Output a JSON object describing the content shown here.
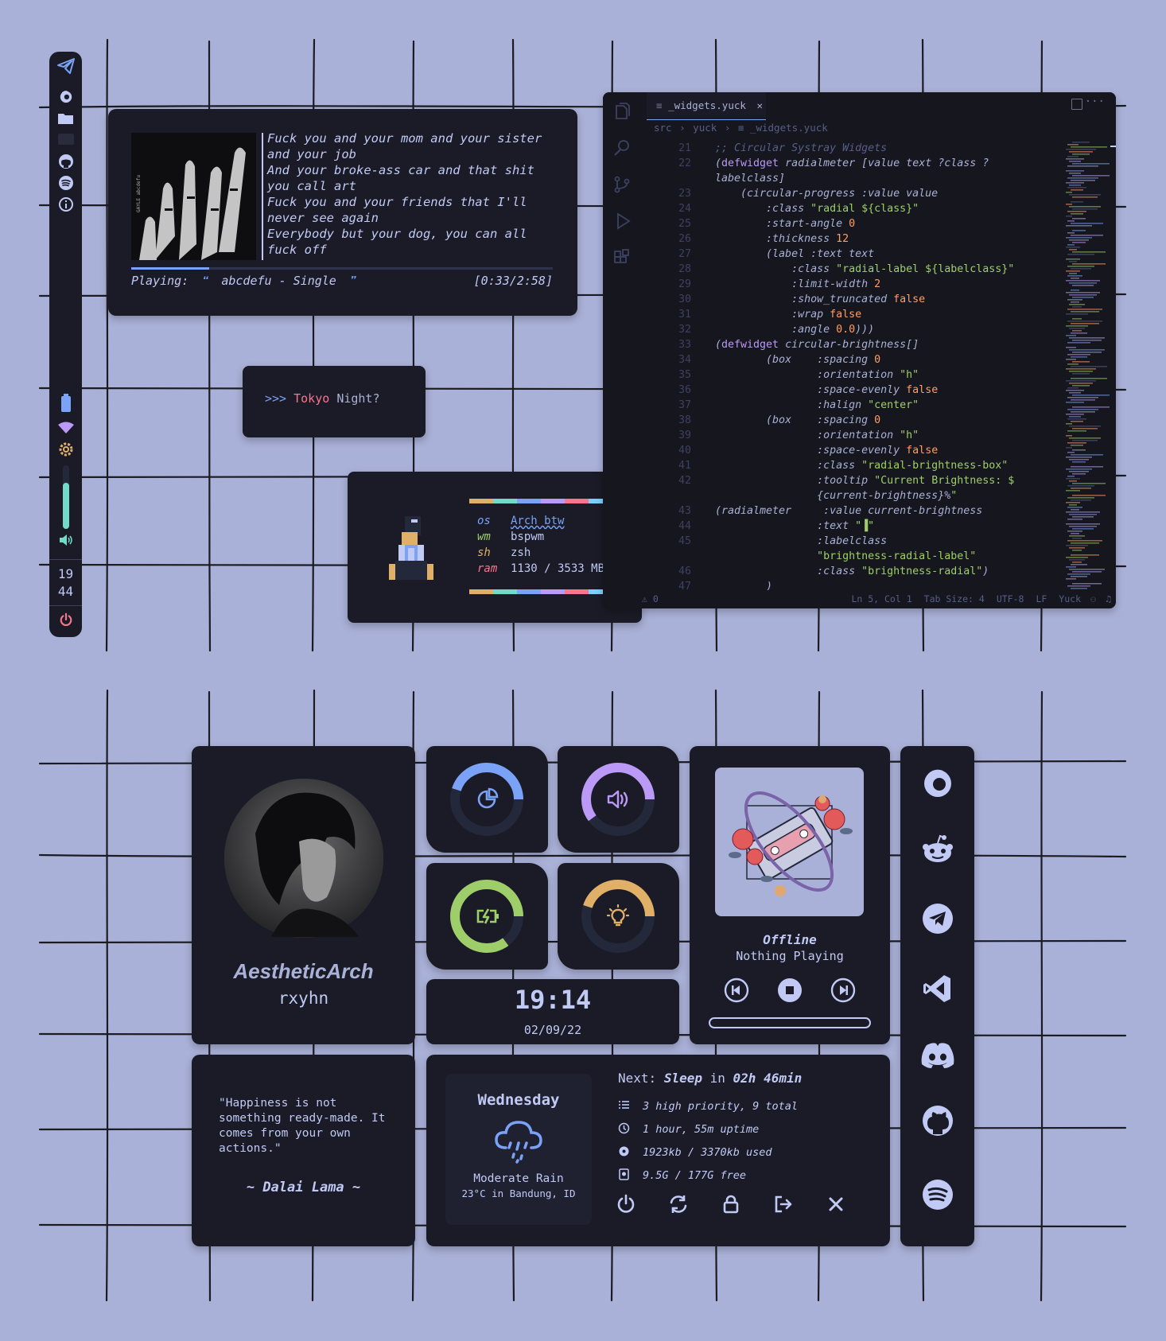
{
  "colors": {
    "background": "#aab1d8",
    "panel": "#1a1b26",
    "accent_blue": "#7aa2f7",
    "accent_purple": "#bb9af7",
    "accent_green": "#9ece6a",
    "accent_orange": "#e0af68",
    "accent_red": "#f7768e",
    "accent_cyan": "#73daca"
  },
  "sidebar": {
    "icons": [
      "telegram-icon",
      "firefox-icon",
      "folder-icon",
      "terminal-icon",
      "github-icon",
      "spotify-icon",
      "info-icon"
    ],
    "status_icons": [
      "battery-icon",
      "wifi-icon",
      "brightness-icon"
    ],
    "brightness_level": 0.72,
    "volume_icon": "volume-icon",
    "clock_hour": "19",
    "clock_minute": "44",
    "power_icon": "power-icon"
  },
  "music": {
    "album_caption": "GAYLE abcdefu",
    "lyrics": [
      "Fuck you and your mom and your sister",
      "and your job",
      "And your broke-ass car and that shit",
      "you call art",
      "Fuck you and your friends that I'll",
      "never see again",
      "Everybody but your dog, you can all",
      "fuck off"
    ],
    "playing_label": "Playing:",
    "open_quote": "❝",
    "track": "abcdefu - Single",
    "close_quote": "❞",
    "time": "[0:33/2:58]",
    "progress": 0.185
  },
  "prompt": {
    "arrows": ">>>",
    "word1": "Tokyo",
    "word2": "Night?"
  },
  "fetch": {
    "rows": [
      {
        "key": "os",
        "value": "Arch btw"
      },
      {
        "key": "wm",
        "value": "bspwm"
      },
      {
        "key": "sh",
        "value": "zsh"
      },
      {
        "key": "ram",
        "value": "1130 / 3533 MB"
      }
    ],
    "bar_colors": [
      "#e0af68",
      "#73daca",
      "#7aa2f7",
      "#bb9af7",
      "#f7768e",
      "#7dcfff"
    ]
  },
  "editor": {
    "tab_title": "_widgets.yuck",
    "breadcrumb": [
      "src",
      "yuck",
      "_widgets.yuck"
    ],
    "activity_icons": [
      "files-icon",
      "search-icon",
      "source-control-icon",
      "run-debug-icon",
      "extensions-icon"
    ],
    "status_left": "0",
    "status_items": [
      "Ln 5, Col 1",
      "Tab Size: 4",
      "UTF-8",
      "LF",
      "Yuck"
    ],
    "lines": [
      {
        "n": "21",
        "t": ";; Circular Systray Widgets"
      },
      {
        "n": "22",
        "t": "(defwidget radialmeter [value text ?class ?"
      },
      {
        "n": "",
        "t": "labelclass]"
      },
      {
        "n": "23",
        "t": "    (circular-progress :value value"
      },
      {
        "n": "24",
        "t": "        :class \"radial ${class}\""
      },
      {
        "n": "25",
        "t": "        :start-angle 0"
      },
      {
        "n": "26",
        "t": "        :thickness 12"
      },
      {
        "n": "27",
        "t": "        (label :text text"
      },
      {
        "n": "28",
        "t": "            :class \"radial-label ${labelclass}\""
      },
      {
        "n": "29",
        "t": "            :limit-width 2"
      },
      {
        "n": "30",
        "t": "            :show_truncated false"
      },
      {
        "n": "31",
        "t": "            :wrap false"
      },
      {
        "n": "32",
        "t": "            :angle 0.0)))"
      },
      {
        "n": "33",
        "t": "(defwidget circular-brightness[]"
      },
      {
        "n": "34",
        "t": "        (box    :spacing 0"
      },
      {
        "n": "35",
        "t": "                :orientation \"h\""
      },
      {
        "n": "36",
        "t": "                :space-evenly false"
      },
      {
        "n": "37",
        "t": "                :halign \"center\""
      },
      {
        "n": "38",
        "t": "        (box    :spacing 0"
      },
      {
        "n": "39",
        "t": "                :orientation \"h\""
      },
      {
        "n": "40",
        "t": "                :space-evenly false"
      },
      {
        "n": "41",
        "t": "                :class \"radial-brightness-box\""
      },
      {
        "n": "42",
        "t": "                :tooltip \"Current Brightness: $"
      },
      {
        "n": "",
        "t": "                {current-brightness}%\""
      },
      {
        "n": "43",
        "t": "(radialmeter     :value current-brightness"
      },
      {
        "n": "44",
        "t": "                :text \"▐\""
      },
      {
        "n": "45",
        "t": "                :labelclass"
      },
      {
        "n": "",
        "t": "                \"brightness-radial-label\""
      },
      {
        "n": "46",
        "t": "                :class \"brightness-radial\")"
      },
      {
        "n": "47",
        "t": "        )"
      }
    ]
  },
  "profile": {
    "name": "AestheticArch",
    "username": "rxyhn",
    "avatar_icon": "avatar-icon"
  },
  "meters": [
    {
      "name": "ram-meter",
      "icon": "pie-chart-icon",
      "color": "#7aa2f7",
      "value": 0.45
    },
    {
      "name": "volume-meter",
      "icon": "speaker-icon",
      "color": "#bb9af7",
      "value": 0.6
    },
    {
      "name": "battery-meter",
      "icon": "battery-charging-icon",
      "color": "#9ece6a",
      "value": 0.85
    },
    {
      "name": "brightness-meter",
      "icon": "lightbulb-icon",
      "color": "#e0af68",
      "value": 0.45
    }
  ],
  "clock": {
    "time": "19:14",
    "date": "02/09/22"
  },
  "player": {
    "status": "Offline",
    "title": "Nothing Playing",
    "cover_icon": "cassette-roses-icon"
  },
  "apps": [
    "firefox-icon",
    "reddit-icon",
    "telegram-icon",
    "vscode-icon",
    "discord-icon",
    "github-icon",
    "spotify-icon"
  ],
  "quote": {
    "text": "\"Happiness is not something ready-made. It comes from your own actions.\"",
    "author": "~ Dalai Lama ~"
  },
  "weather": {
    "day": "Wednesday",
    "icon": "rain-cloud-icon",
    "condition": "Moderate Rain",
    "temp_location": "23°C in Bandung, ID"
  },
  "agenda": {
    "next_label": "Next:",
    "event": "Sleep",
    "in_word": "in",
    "time_left": "02h 46min",
    "rows": [
      {
        "icon": "list-icon",
        "text": "3 high priority, 9 total"
      },
      {
        "icon": "clock-icon",
        "text": "1 hour, 55m uptime"
      },
      {
        "icon": "memory-icon",
        "text": "1923kb / 3370kb used"
      },
      {
        "icon": "disk-icon",
        "text": "9.5G / 177G free"
      }
    ],
    "actions": [
      "power-icon",
      "reboot-icon",
      "lock-icon",
      "logout-icon",
      "close-icon"
    ]
  }
}
